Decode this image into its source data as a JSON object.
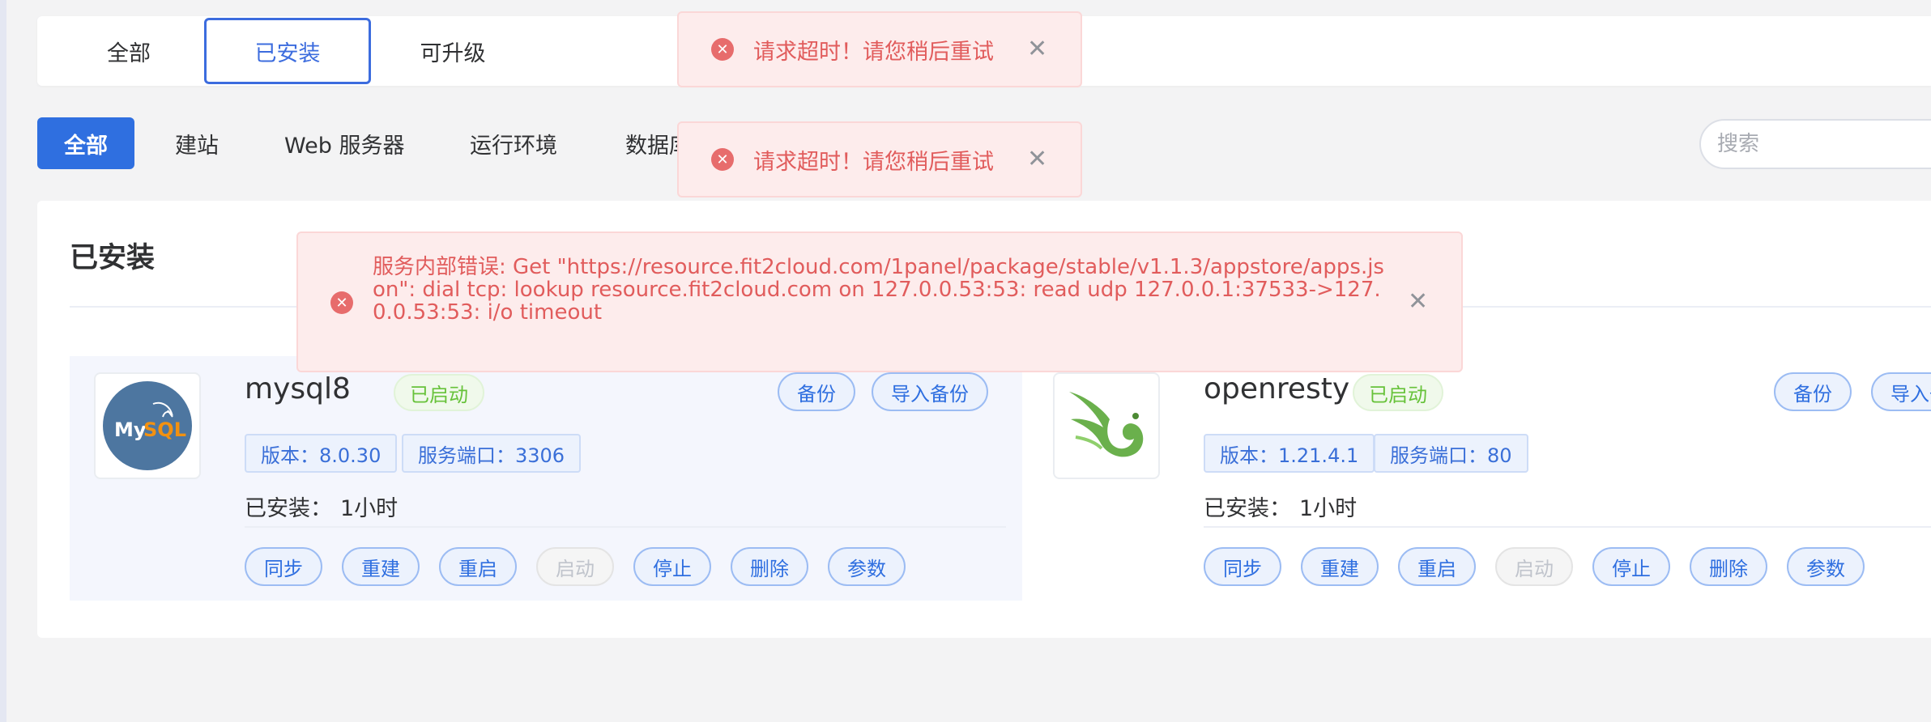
{
  "top_tabs": [
    "全部",
    "已安装",
    "可升级"
  ],
  "categories": [
    "全部",
    "建站",
    "Web 服务器",
    "运行环境",
    "数据库"
  ],
  "search": {
    "placeholder": "搜索"
  },
  "panel": {
    "title": "已安装"
  },
  "toasts": {
    "timeout_message": "请求超时！请您稍后重试",
    "error_message": "服务内部错误: Get \"https://resource.fit2cloud.com/1panel/package/stable/v1.1.3/appstore/apps.json\": dial tcp: lookup resource.fit2cloud.com on 127.0.0.53:53: read udp 127.0.0.1:37533->127.0.0.53:53: i/o timeout"
  },
  "apps": [
    {
      "name": "mysql8",
      "status": "已启动",
      "version_label": "版本：8.0.30",
      "port_label": "服务端口：3306",
      "installed_label": "已安装：",
      "installed_time": "1小时",
      "logo_text_1": "My",
      "logo_text_2": "SQL",
      "top_buttons": [
        "备份",
        "导入备份"
      ],
      "actions": [
        "同步",
        "重建",
        "重启",
        "启动",
        "停止",
        "删除",
        "参数"
      ]
    },
    {
      "name": "openresty",
      "status": "已启动",
      "version_label": "版本：1.21.4.1",
      "port_label": "服务端口：80",
      "installed_label": "已安装：",
      "installed_time": "1小时",
      "top_buttons": [
        "备份",
        "导入备份"
      ],
      "actions": [
        "同步",
        "重建",
        "重启",
        "启动",
        "停止",
        "删除",
        "参数"
      ]
    }
  ],
  "colors": {
    "primary": "#2f6fe0",
    "success": "#67c23a",
    "error": "#e15c5c"
  },
  "icons": {
    "error": "circle-x-icon",
    "close": "close-icon",
    "mysql_logo": "mysql-logo-icon",
    "openresty_logo": "openresty-bird-logo-icon"
  }
}
